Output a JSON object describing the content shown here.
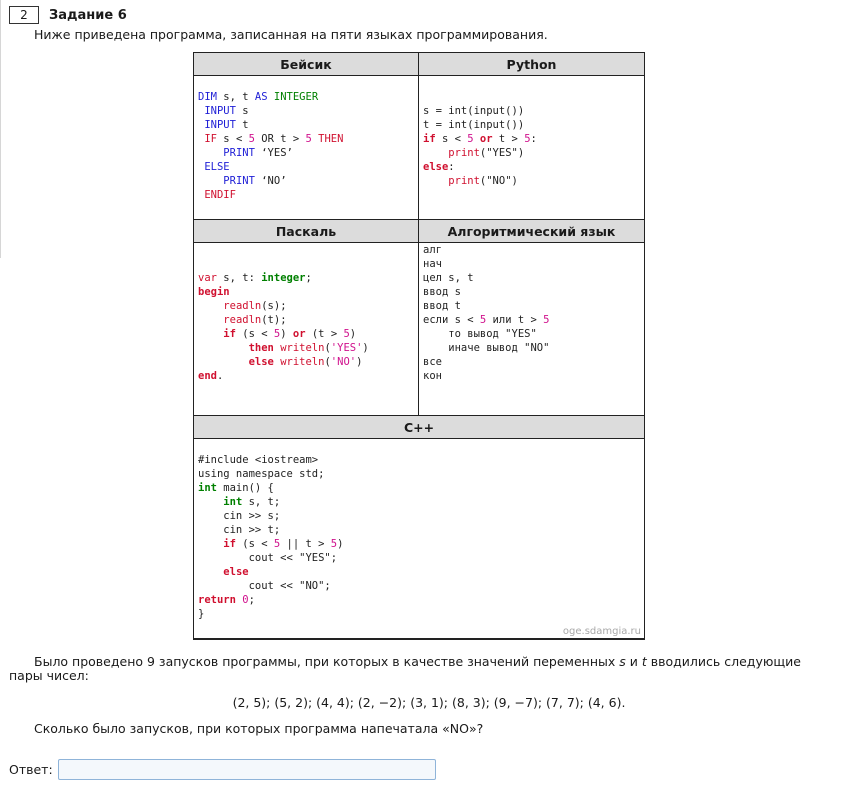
{
  "task": {
    "number": "2",
    "title": "Задание 6",
    "intro": "Ниже приведена программа, записанная на пяти языках программирования."
  },
  "languages": {
    "basic": "Бейсик",
    "python": "Python",
    "pascal": "Паскаль",
    "algorithmic": "Алгоритмический язык",
    "cpp": "C++"
  },
  "watermark": "oge.sdamgia.ru",
  "question": {
    "para_start": "Было проведено 9 запусков программы, при которых в качестве значений переменных",
    "var_s": "s",
    "and": "и",
    "var_t": "t",
    "para_end": "вводились следующие пары чисел:",
    "pairs": "(2, 5); (5, 2); (4, 4); (2, −2); (3, 1); (8, 3); (9, −7); (7, 7); (4, 6).",
    "prompt": "Сколько было запусков, при которых программа напечатала «NO»?"
  },
  "answer": {
    "label": "Ответ:",
    "value": ""
  }
}
